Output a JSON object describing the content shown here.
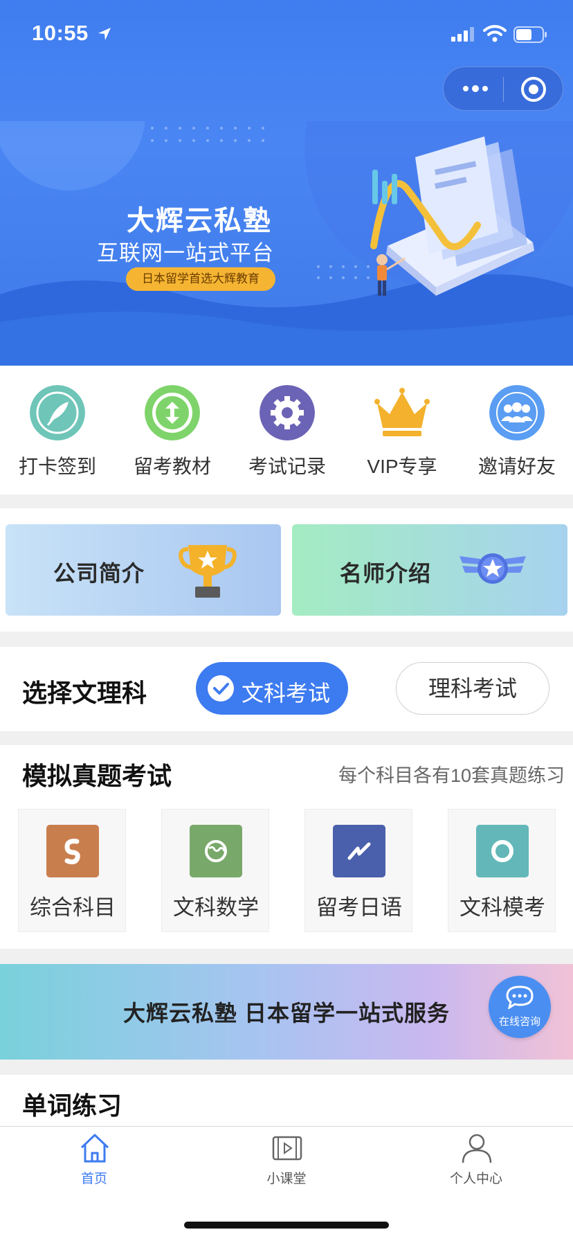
{
  "status_bar": {
    "time": "10:55"
  },
  "banner": {
    "title": "大辉云私塾",
    "subtitle": "互联网一站式平台",
    "tag": "日本留学首选大辉教育",
    "colors": {
      "bg": "#3f7df0",
      "tag": "#f5b533"
    }
  },
  "quick_menu": [
    {
      "label": "打卡签到",
      "icon": "quill-icon",
      "color": "#6ec5b8"
    },
    {
      "label": "留考教材",
      "icon": "up-down-arrow-icon",
      "color": "#7ed46a"
    },
    {
      "label": "考试记录",
      "icon": "gear-icon",
      "color": "#6b63b5"
    },
    {
      "label": "VIP专享",
      "icon": "crown-icon",
      "color": "#f3b12e"
    },
    {
      "label": "邀请好友",
      "icon": "people-icon",
      "color": "#5a9df2"
    }
  ],
  "intro_cards": [
    {
      "label": "公司简介",
      "icon": "trophy-icon"
    },
    {
      "label": "名师介绍",
      "icon": "star-badge-icon"
    }
  ],
  "subject_select": {
    "title": "选择文理科",
    "options": [
      {
        "label": "文科考试",
        "selected": true
      },
      {
        "label": "理科考试",
        "selected": false
      }
    ]
  },
  "mock_exam": {
    "title": "模拟真题考试",
    "note": "每个科目各有10套真题练习",
    "subjects": [
      {
        "label": "综合科目",
        "icon": "swirl-icon",
        "color": "#c97e4e"
      },
      {
        "label": "文科数学",
        "icon": "globe-icon",
        "color": "#78a86a"
      },
      {
        "label": "留考日语",
        "icon": "lightning-icon",
        "color": "#4a60ac"
      },
      {
        "label": "文科模考",
        "icon": "ring-icon",
        "color": "#63b7b8"
      }
    ]
  },
  "promo": {
    "text": "大辉云私塾  日本留学一站式服务",
    "chat_label": "在线咨询"
  },
  "words": {
    "title": "单词练习"
  },
  "tab_bar": [
    {
      "label": "首页",
      "icon": "home-icon",
      "active": true
    },
    {
      "label": "小课堂",
      "icon": "video-icon",
      "active": false
    },
    {
      "label": "个人中心",
      "icon": "user-icon",
      "active": false
    }
  ],
  "accent_color": "#3d7bf0"
}
